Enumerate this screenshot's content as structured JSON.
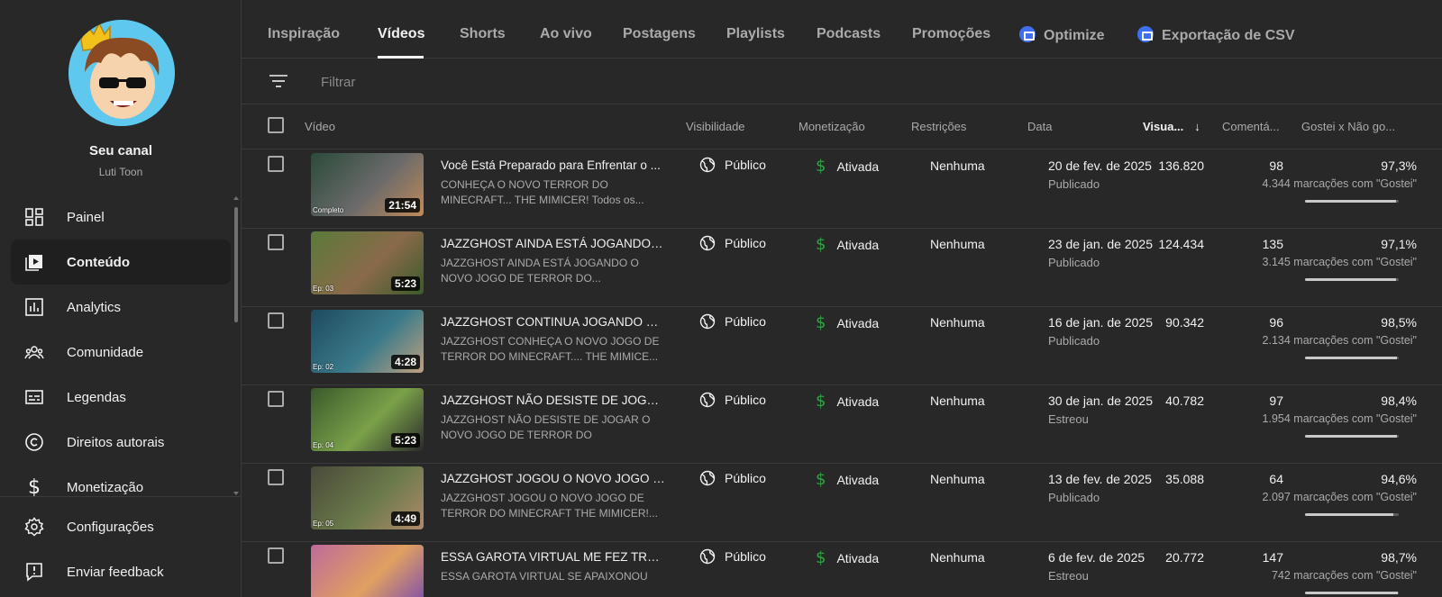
{
  "channel": {
    "title": "Seu canal",
    "name": "Luti Toon"
  },
  "sidebar": {
    "items": [
      {
        "label": "Painel",
        "icon": "dashboard-icon"
      },
      {
        "label": "Conteúdo",
        "icon": "content-icon",
        "active": true
      },
      {
        "label": "Analytics",
        "icon": "analytics-icon"
      },
      {
        "label": "Comunidade",
        "icon": "community-icon"
      },
      {
        "label": "Legendas",
        "icon": "subtitles-icon"
      },
      {
        "label": "Direitos autorais",
        "icon": "copyright-icon"
      },
      {
        "label": "Monetização",
        "icon": "dollar-icon"
      }
    ],
    "bottom": [
      {
        "label": "Configurações",
        "icon": "gear-icon"
      },
      {
        "label": "Enviar feedback",
        "icon": "feedback-icon"
      }
    ]
  },
  "tabs": [
    {
      "label": "Inspiração"
    },
    {
      "label": "Vídeos",
      "active": true
    },
    {
      "label": "Shorts"
    },
    {
      "label": "Ao vivo"
    },
    {
      "label": "Postagens"
    },
    {
      "label": "Playlists"
    },
    {
      "label": "Podcasts"
    },
    {
      "label": "Promoções"
    },
    {
      "label": "Optimize",
      "icon": "extension-icon"
    },
    {
      "label": "Exportação de CSV",
      "icon": "extension-icon"
    }
  ],
  "filter": {
    "placeholder": "Filtrar"
  },
  "columns": {
    "video": "Vídeo",
    "visibility": "Visibilidade",
    "monetization": "Monetização",
    "restrictions": "Restrições",
    "date": "Data",
    "views": "Visua...",
    "comments": "Comentá...",
    "likes": "Gostei x Não go..."
  },
  "rows": [
    {
      "title": "Você Está Preparado para Enfrentar o ...",
      "desc": "CONHEÇA O NOVO TERROR DO MINECRAFT... THE MIMICER! Todos os...",
      "duration": "21:54",
      "badge": "Completo",
      "visibility": "Público",
      "monetization": "Ativada",
      "restrictions": "Nenhuma",
      "date": "20 de fev. de 2025",
      "status": "Publicado",
      "views": "136.820",
      "comments": "98",
      "like_pct": "97,3%",
      "like_count": "4.344 marcações com \"Gostei\"",
      "like_ratio": 0.973,
      "thumb_colors": [
        "#2b4a3a",
        "#6a6a6a",
        "#c08a5a"
      ]
    },
    {
      "title": "JAZZGHOST AINDA ESTÁ JOGANDO O...",
      "desc": "JAZZGHOST AINDA ESTÁ JOGANDO O NOVO JOGO DE TERROR DO...",
      "duration": "5:23",
      "badge": "Ep: 03",
      "visibility": "Público",
      "monetization": "Ativada",
      "restrictions": "Nenhuma",
      "date": "23 de jan. de 2025",
      "status": "Publicado",
      "views": "124.434",
      "comments": "135",
      "like_pct": "97,1%",
      "like_count": "3.145 marcações com \"Gostei\"",
      "like_ratio": 0.971,
      "thumb_colors": [
        "#5a7a3a",
        "#8a6a4a",
        "#3a5a2a"
      ]
    },
    {
      "title": "JAZZGHOST CONTINUA JOGANDO O ...",
      "desc": "JAZZGHOST CONHEÇA O NOVO JOGO DE TERROR DO MINECRAFT.... THE MIMICE...",
      "duration": "4:28",
      "badge": "Ep: 02",
      "visibility": "Público",
      "monetization": "Ativada",
      "restrictions": "Nenhuma",
      "date": "16 de jan. de 2025",
      "status": "Publicado",
      "views": "90.342",
      "comments": "96",
      "like_pct": "98,5%",
      "like_count": "2.134 marcações com \"Gostei\"",
      "like_ratio": 0.985,
      "thumb_colors": [
        "#1e4a5e",
        "#3a7a8a",
        "#c0a080"
      ]
    },
    {
      "title": "JAZZGHOST NÃO DESISTE DE JOGAR ...",
      "desc": "JAZZGHOST NÃO DESISTE DE JOGAR O NOVO JOGO DE TERROR DO MINECRAFT....",
      "duration": "5:23",
      "badge": "Ep: 04",
      "visibility": "Público",
      "monetization": "Ativada",
      "restrictions": "Nenhuma",
      "date": "30 de jan. de 2025",
      "status": "Estreou",
      "views": "40.782",
      "comments": "97",
      "like_pct": "98,4%",
      "like_count": "1.954 marcações com \"Gostei\"",
      "like_ratio": 0.984,
      "thumb_colors": [
        "#3a5a2a",
        "#7aa04a",
        "#2a2a2a"
      ]
    },
    {
      "title": "JAZZGHOST JOGOU O NOVO JOGO D...",
      "desc": "JAZZGHOST JOGOU O NOVO JOGO DE TERROR DO MINECRAFT THE MIMICER!...",
      "duration": "4:49",
      "badge": "Ep: 05",
      "visibility": "Público",
      "monetization": "Ativada",
      "restrictions": "Nenhuma",
      "date": "13 de fev. de 2025",
      "status": "Publicado",
      "views": "35.088",
      "comments": "64",
      "like_pct": "94,6%",
      "like_count": "2.097 marcações com \"Gostei\"",
      "like_ratio": 0.946,
      "thumb_colors": [
        "#4a4a3a",
        "#6a7a4a",
        "#b08a6a"
      ]
    },
    {
      "title": "ESSA GAROTA VIRTUAL ME FEZ TRAB...",
      "desc": "ESSA GAROTA VIRTUAL SE APAIXONOU",
      "duration": "",
      "badge": "",
      "visibility": "Público",
      "monetization": "Ativada",
      "restrictions": "Nenhuma",
      "date": "6 de fev. de 2025",
      "status": "Estreou",
      "views": "20.772",
      "comments": "147",
      "like_pct": "98,7%",
      "like_count": "742 marcações com \"Gostei\"",
      "like_ratio": 0.987,
      "thumb_colors": [
        "#c06a9a",
        "#e0a060",
        "#7a4ab0"
      ]
    }
  ]
}
